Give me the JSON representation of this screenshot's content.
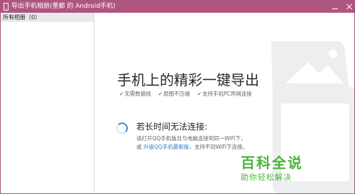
{
  "window": {
    "title": "导出手机相册(墨都 的 Android手机)"
  },
  "sidebar": {
    "all_albums_label": "所有相册（0）"
  },
  "main": {
    "headline": "手机上的精彩一键导出",
    "features": [
      {
        "check": "✔",
        "label": "无需数据线"
      },
      {
        "check": "✔",
        "label": "原图不压缩"
      },
      {
        "check": "✔",
        "label": "支持手机PC异网连接"
      }
    ],
    "status": {
      "title": "若长时间无法连接:",
      "line1": "请打开QQ手机版且与电脑连接到同一WiFi下，",
      "line2_prefix": "或",
      "line2_link": "升级QQ手机最新版",
      "line2_suffix": "，支持不同WiFi下连接。"
    }
  },
  "watermark": {
    "title": "百科全说",
    "subtitle": "助你轻松解决"
  },
  "colors": {
    "titlebar": "#b0567e",
    "accent": "#3c8ad0",
    "watermark": "#49b53a"
  }
}
